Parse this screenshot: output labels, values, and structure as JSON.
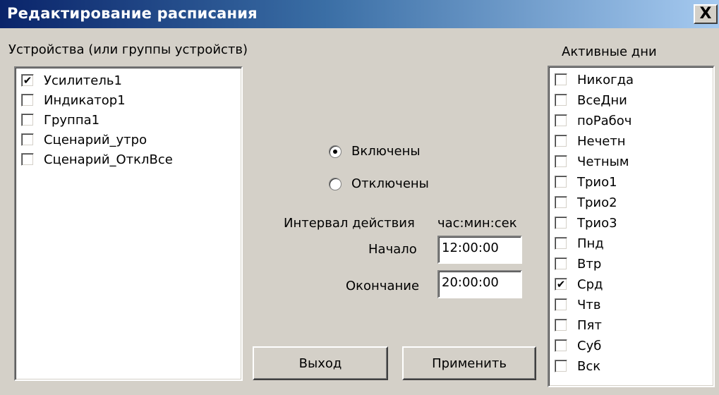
{
  "window": {
    "title": "Редактирование расписания",
    "close_label": "X"
  },
  "devices": {
    "header": "Устройства (или группы устройств)",
    "items": [
      {
        "label": "Усилитель1",
        "checked": true
      },
      {
        "label": "Индикатор1",
        "checked": false
      },
      {
        "label": "Группа1",
        "checked": false
      },
      {
        "label": "Сценарий_утро",
        "checked": false
      },
      {
        "label": "Сценарий_ОтклВсе",
        "checked": false
      }
    ]
  },
  "state": {
    "enabled_label": "Включены",
    "disabled_label": "Отключены",
    "selected": "enabled"
  },
  "interval": {
    "label": "Интервал действия",
    "format": "час:мин:сек",
    "start_label": "Начало",
    "start_value": "12:00:00",
    "end_label": "Окончание",
    "end_value": "20:00:00"
  },
  "buttons": {
    "exit_label": "Выход",
    "apply_label": "Применить"
  },
  "days": {
    "header": "Активные дни",
    "items": [
      {
        "label": "Никогда",
        "checked": false
      },
      {
        "label": "ВсеДни",
        "checked": false
      },
      {
        "label": "поРабоч",
        "checked": false
      },
      {
        "label": "Нечетн",
        "checked": false
      },
      {
        "label": "Четным",
        "checked": false
      },
      {
        "label": "Трио1",
        "checked": false
      },
      {
        "label": "Трио2",
        "checked": false
      },
      {
        "label": "Трио3",
        "checked": false
      },
      {
        "label": "Пнд",
        "checked": false
      },
      {
        "label": "Втр",
        "checked": false
      },
      {
        "label": "Срд",
        "checked": true
      },
      {
        "label": "Чтв",
        "checked": false
      },
      {
        "label": "Пят",
        "checked": false
      },
      {
        "label": "Суб",
        "checked": false
      },
      {
        "label": "Вск",
        "checked": false
      }
    ]
  },
  "check_glyph": "✔"
}
